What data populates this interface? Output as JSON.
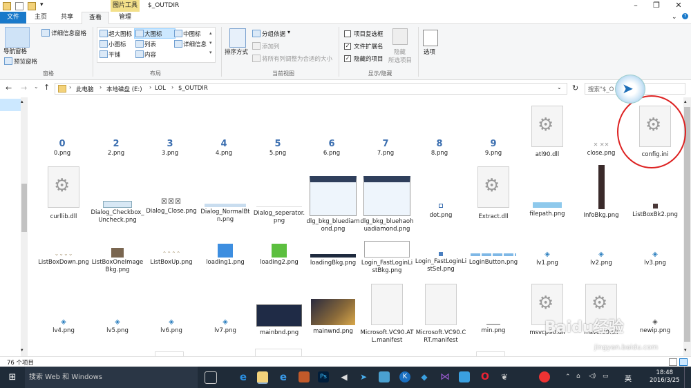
{
  "window": {
    "title": "$_OUTDIR",
    "context_tab": "图片工具"
  },
  "tabs": [
    "文件",
    "主页",
    "共享",
    "查看",
    "管理"
  ],
  "ribbon": {
    "pane": {
      "nav_pane": "导航窗格",
      "preview_pane": "预览窗格",
      "details_pane": "详细信息窗格",
      "label": "窗格"
    },
    "layout": {
      "items": [
        "超大图标",
        "大图标",
        "中图标",
        "小图标",
        "列表",
        "详细信息",
        "平铺",
        "内容"
      ],
      "label": "布局"
    },
    "current_view": {
      "sort": "排序方式",
      "group_by": "分组依据",
      "add_column": "添加列",
      "fit_columns": "将所有列调整为合适的大小",
      "label": "当前视图"
    },
    "show_hide": {
      "item_checkbox": "项目复选框",
      "file_ext": "文件扩展名",
      "hidden_items": "隐藏的项目",
      "hide_selected": "隐藏",
      "hide_selected2": "所选项目",
      "options": "选项",
      "label": "显示/隐藏"
    }
  },
  "address": {
    "crumbs": [
      "此电脑",
      "本地磁盘 (E:)",
      "LOL",
      "$_OUTDIR"
    ],
    "search_placeholder": "搜索\"$_O"
  },
  "files": {
    "row1": [
      "0.png",
      "2.png",
      "3.png",
      "4.png",
      "5.png",
      "6.png",
      "7.png",
      "8.png",
      "9.png",
      "atl90.dll",
      "close.png",
      "config.ini"
    ],
    "row1_glyphs": [
      "0",
      "2",
      "3",
      "4",
      "5",
      "6",
      "7",
      "8",
      "9"
    ],
    "row2": [
      "curllib.dll",
      "Dialog_Checkbox_Uncheck.png",
      "Dialog_Close.png",
      "Dialog_NormalBtn.png",
      "Dialog_seperator.png",
      "dlg_bkg_bluediamond.png",
      "dlg_bkg_bluehaohuadiamond.png",
      "dot.png",
      "Extract.dll",
      "filepath.png",
      "InfoBkg.png",
      "ListBoxBk2.png"
    ],
    "row3": [
      "ListBoxDown.png",
      "ListBoxOneImageBkg.png",
      "ListBoxUp.png",
      "loading1.png",
      "loading2.png",
      "loadingBkg.png",
      "Login_FastLoginListBkg.png",
      "Login_FastLoginListSel.png",
      "LoginButton.png",
      "lv1.png",
      "lv2.png",
      "lv3.png"
    ],
    "row4": [
      "lv4.png",
      "lv5.png",
      "lv6.png",
      "lv7.png",
      "mainbnd.png",
      "mainwnd.png",
      "Microsoft.VC90.ATL.manifest",
      "Microsoft.VC90.CRT.manifest",
      "min.png",
      "msvcp90.dll",
      "msvcr90.dll",
      "newip.png"
    ]
  },
  "status": {
    "count": "76 个项目"
  },
  "taskbar": {
    "search": "搜索 Web 和 Windows",
    "time": "18:48",
    "date": "2016/3/25",
    "ime": "英"
  },
  "watermark": {
    "text": "Baidu经验",
    "url": "jingyan.baidu.com"
  },
  "colors": {
    "accent": "#1979ca",
    "taskbar": "#1f2b38",
    "annotation": "#dd2222"
  }
}
